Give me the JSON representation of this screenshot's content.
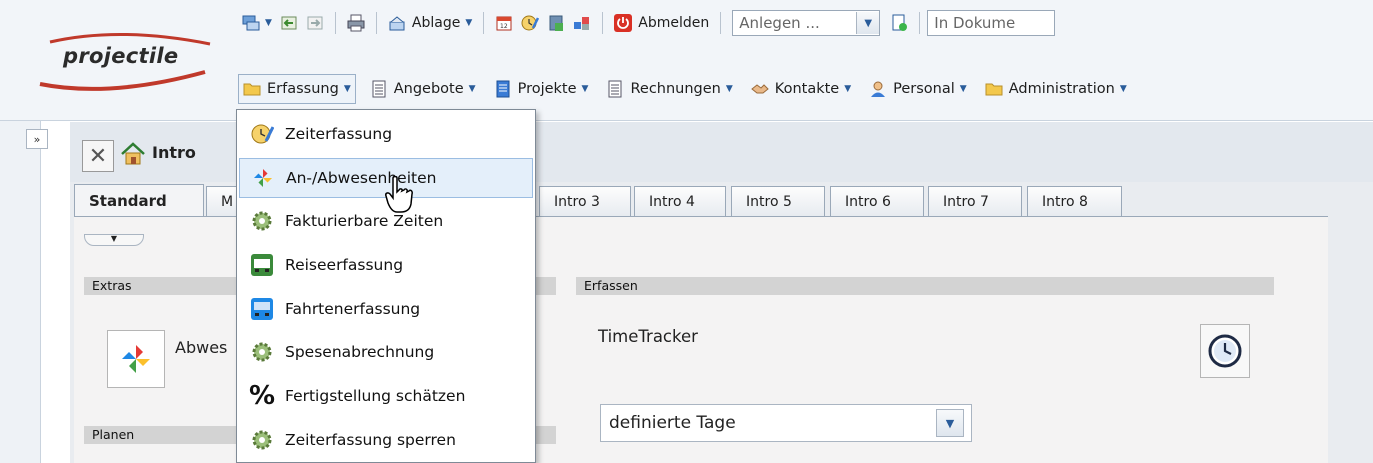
{
  "header": {
    "logo_text": "projectile",
    "toolbar1": {
      "ablage": "Ablage",
      "abmelden": "Abmelden",
      "anlegen_placeholder": "Anlegen ...",
      "search_value": "In Dokume"
    },
    "toolbar2": [
      {
        "label": "Erfassung",
        "icon": "folder-icon"
      },
      {
        "label": "Angebote",
        "icon": "document-grid-icon"
      },
      {
        "label": "Projekte",
        "icon": "blue-document-icon"
      },
      {
        "label": "Rechnungen",
        "icon": "document-grid-icon"
      },
      {
        "label": "Kontakte",
        "icon": "handshake-icon"
      },
      {
        "label": "Personal",
        "icon": "person-icon"
      },
      {
        "label": "Administration",
        "icon": "folder-icon"
      }
    ]
  },
  "panel": {
    "title": "Intro",
    "expand_label": "»",
    "tabs": [
      "Standard",
      "M",
      "Intro 3",
      "Intro 4",
      "Intro 5",
      "Intro 6",
      "Intro 7",
      "Intro 8"
    ]
  },
  "sections": {
    "extras": "Extras",
    "erfassen": "Erfassen",
    "planen": "Planen",
    "extras_item": "Abwes",
    "timetracker": "TimeTracker",
    "select_value": "definierte Tage"
  },
  "menu": {
    "items": [
      {
        "label": "Zeiterfassung",
        "icon": "clock-pencil-icon"
      },
      {
        "label": "An-/Abwesenheiten",
        "icon": "pinwheel-icon"
      },
      {
        "label": "Fakturierbare Zeiten",
        "icon": "gear-icon"
      },
      {
        "label": "Reiseerfassung",
        "icon": "train-icon"
      },
      {
        "label": "Fahrtenerfassung",
        "icon": "bus-icon"
      },
      {
        "label": "Spesenabrechnung",
        "icon": "gear-icon"
      },
      {
        "label": "Fertigstellung schätzen",
        "icon": "percent-icon"
      },
      {
        "label": "Zeiterfassung sperren",
        "icon": "gear-icon"
      }
    ],
    "highlighted_index": 1
  },
  "colors": {
    "accent": "#2a5c9a",
    "highlight": "#e4effa",
    "logout_red": "#d93025"
  }
}
